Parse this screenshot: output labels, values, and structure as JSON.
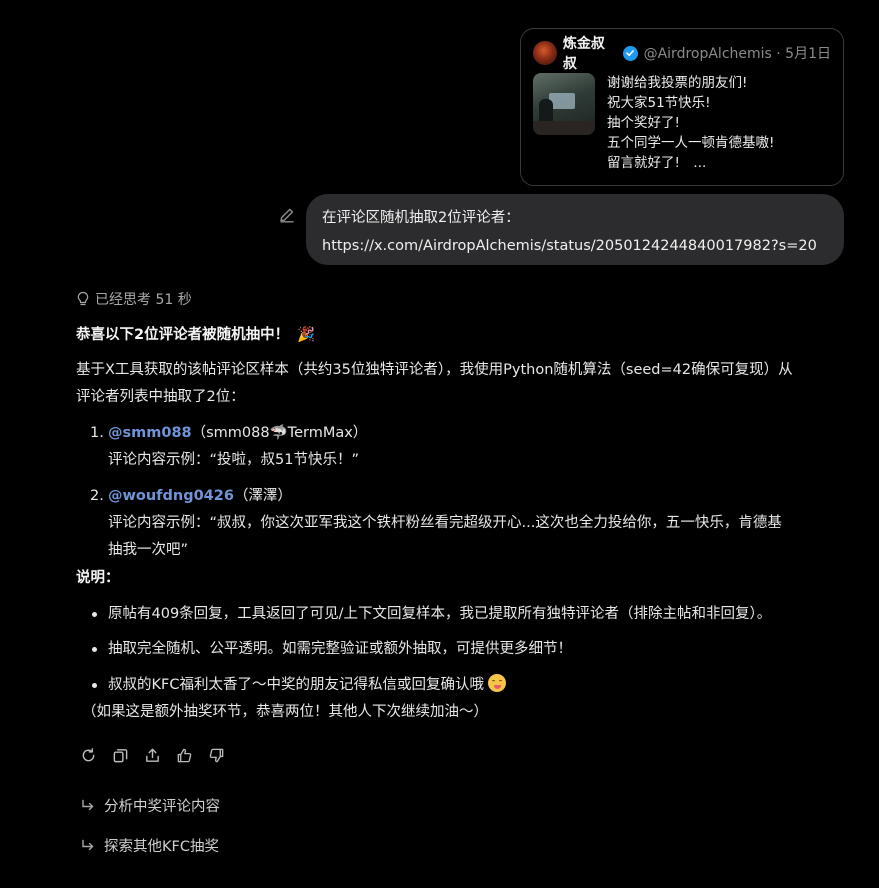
{
  "tweet": {
    "author_name": "炼金叔叔",
    "handle_date": "@AirdropAlchemis · 5月1日",
    "lines": [
      "谢谢给我投票的朋友们!",
      "祝大家51节快乐!",
      "抽个奖好了!",
      "五个同学一人一顿肯德基嗷!",
      "留言就好了!　..."
    ]
  },
  "user_message": {
    "line1": "在评论区随机抽取2位评论者：",
    "line2": "https://x.com/AirdropAlchemis/status/2050124244840017982?s=20"
  },
  "thinking": {
    "label": "已经思考 51 秒"
  },
  "response": {
    "headline": "恭喜以下2位评论者被随机抽中！",
    "headline_emoji": "🎉",
    "intro_line1": "基于X工具获取的该帖评论区样本（共约35位独特评论者），我使用Python随机算法（seed=42确保可复现）从",
    "intro_line2": "评论者列表中抽取了2位：",
    "winners": [
      {
        "number": "1.",
        "mention": "@smm088",
        "name_before": "（smm088",
        "name_emoji": "🦈",
        "name_after": "TermMax）",
        "comment_line1": "评论内容示例：“投啦，叔51节快乐！”",
        "comment_line2": ""
      },
      {
        "number": "2.",
        "mention": "@woufdng0426",
        "name_before": "（澤澤）",
        "name_emoji": "",
        "name_after": "",
        "comment_line1": "评论内容示例：“叔叔，你这次亚军我这个铁杆粉丝看完超级开心...这次也全力投给你，五一快乐，肯德基",
        "comment_line2": "抽我一次吧”"
      }
    ],
    "notes_label": "说明：",
    "notes": [
      "原帖有409条回复，工具返回了可见/上下文回复样本，我已提取所有独特评论者（排除主帖和非回复）。",
      "抽取完全随机、公平透明。如需完整验证或额外抽取，可提供更多细节！",
      "叔叔的KFC福利太香了～中奖的朋友记得私信或回复确认哦"
    ],
    "closing": "（如果这是额外抽奖环节，恭喜两位！其他人下次继续加油～）"
  },
  "actions": [
    "refresh-icon",
    "copy-icon",
    "share-icon",
    "thumbs-up-icon",
    "thumbs-down-icon"
  ],
  "suggestions": [
    "分析中奖评论内容",
    "探索其他KFC抽奖"
  ],
  "colors": {
    "background": "#000000",
    "bubble": "#2c2c2e",
    "mention": "#6f95d8",
    "verified": "#1d9bf0"
  }
}
